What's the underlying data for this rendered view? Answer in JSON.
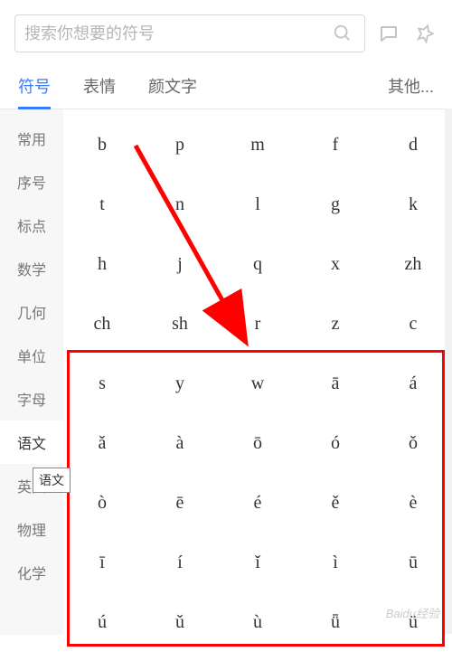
{
  "search": {
    "placeholder": "搜索你想要的符号"
  },
  "tabs": {
    "items": [
      "符号",
      "表情",
      "颜文字"
    ],
    "other": "其他..."
  },
  "sidebar": {
    "items": [
      "常用",
      "序号",
      "标点",
      "数学",
      "几何",
      "单位",
      "字母",
      "语文",
      "英文",
      "物理",
      "化学"
    ],
    "selectedIndex": 7
  },
  "tooltip": {
    "text": "语文"
  },
  "grid": {
    "rows": [
      [
        "b",
        "p",
        "m",
        "f",
        "d"
      ],
      [
        "t",
        "n",
        "l",
        "g",
        "k"
      ],
      [
        "h",
        "j",
        "q",
        "x",
        "zh"
      ],
      [
        "ch",
        "sh",
        "r",
        "z",
        "c"
      ],
      [
        "s",
        "y",
        "w",
        "ā",
        "á"
      ],
      [
        "ǎ",
        "à",
        "ō",
        "ó",
        "ǒ"
      ],
      [
        "ò",
        "ē",
        "é",
        "ě",
        "è"
      ],
      [
        "ī",
        "í",
        "ǐ",
        "ì",
        "ū"
      ],
      [
        "ú",
        "ǔ",
        "ù",
        "ǖ",
        "ü"
      ]
    ]
  },
  "watermark": "Baidu经验"
}
